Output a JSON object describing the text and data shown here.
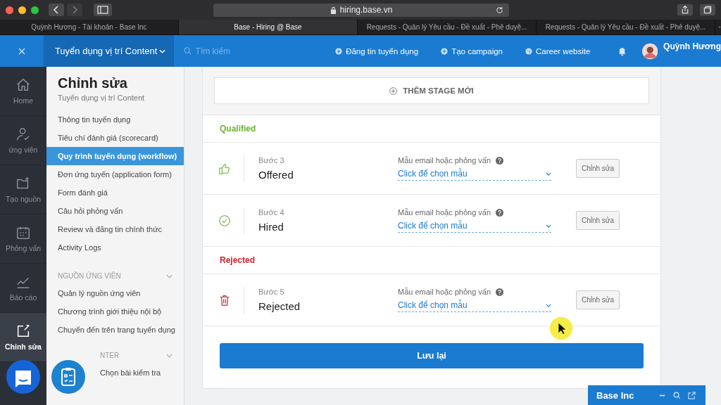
{
  "browser": {
    "url": "hiring.base.vn",
    "tabs": [
      {
        "title": "Quỳnh Hương - Tài khoản - Base Inc",
        "selected": false
      },
      {
        "title": "Base - Hiring @ Base",
        "selected": true
      },
      {
        "title": "Requests - Quản lý Yêu cầu - Đề xuất - Phê duyệ...",
        "selected": false
      },
      {
        "title": "Requests - Quản lý Yêu cầu - Đề xuất - Phê duyệ...",
        "selected": false
      }
    ]
  },
  "header": {
    "job_selector": "Tuyển dụng vị trí Content",
    "search": {
      "placeholder": "Tìm kiếm"
    },
    "links": [
      "Đăng tin tuyển dụng",
      "Tạo campaign",
      "Career website"
    ],
    "user": "Quỳnh Hương"
  },
  "rail": [
    {
      "label": "Home",
      "kind": "home",
      "selected": false
    },
    {
      "label": "ứng viên",
      "kind": "person",
      "selected": false
    },
    {
      "label": "Tạo nguồn",
      "kind": "folder",
      "selected": false
    },
    {
      "label": "Phỏng vấn",
      "kind": "calendar",
      "selected": false
    },
    {
      "label": "Báo cáo",
      "kind": "chart",
      "selected": false
    },
    {
      "label": "Chỉnh sửa",
      "kind": "edit",
      "selected": true
    }
  ],
  "sidebar": {
    "title": "Chỉnh sửa",
    "subtitle": "Tuyển dụng vị trí Content",
    "items": [
      {
        "label": "Thông tin tuyển dụng",
        "selected": false
      },
      {
        "label": "Tiêu chí đánh giá (scorecard)",
        "selected": false
      },
      {
        "label": "Quy trình tuyển dụng (workflow)",
        "selected": true
      },
      {
        "label": "Đơn ứng tuyển (application form)",
        "selected": false
      },
      {
        "label": "Form đánh giá",
        "selected": false
      },
      {
        "label": "Câu hỏi phỏng vấn",
        "selected": false
      },
      {
        "label": "Review và đăng tin chính thức",
        "selected": false
      },
      {
        "label": "Activity Logs",
        "selected": false
      }
    ],
    "sections": [
      {
        "title": "NGUỒN ỨNG VIÊN",
        "items": [
          "Quản lý nguồn ứng viên",
          "Chương trình giới thiệu nội bộ",
          "Chuyển đến trên trang tuyển dụng"
        ]
      },
      {
        "title": "NTER",
        "items": [
          "Chọn bài kiểm tra"
        ]
      }
    ]
  },
  "add_stage": "THÊM STAGE MỚI",
  "groups": [
    {
      "title": "Qualified",
      "kind": "qualified",
      "stages": [
        {
          "kind": "thumb",
          "step": "Bước 3",
          "name": "Offered",
          "template_label": "Mẫu email hoặc phỏng vấn",
          "template_placeholder": "Click để chọn mẫu",
          "edit": "Chỉnh sửa"
        },
        {
          "kind": "check",
          "step": "Bước 4",
          "name": "Hired",
          "template_label": "Mẫu email hoặc phỏng vấn",
          "template_placeholder": "Click để chọn mẫu",
          "edit": "Chỉnh sửa"
        }
      ]
    },
    {
      "title": "Rejected",
      "kind": "rejected",
      "stages": [
        {
          "kind": "trash",
          "step": "Bước 5",
          "name": "Rejected",
          "template_label": "Mẫu email hoặc phỏng vấn",
          "template_placeholder": "Click để chọn mẫu",
          "edit": "Chỉnh sửa"
        }
      ]
    }
  ],
  "save": "Lưu lại",
  "widget": {
    "title": "Base Inc"
  }
}
